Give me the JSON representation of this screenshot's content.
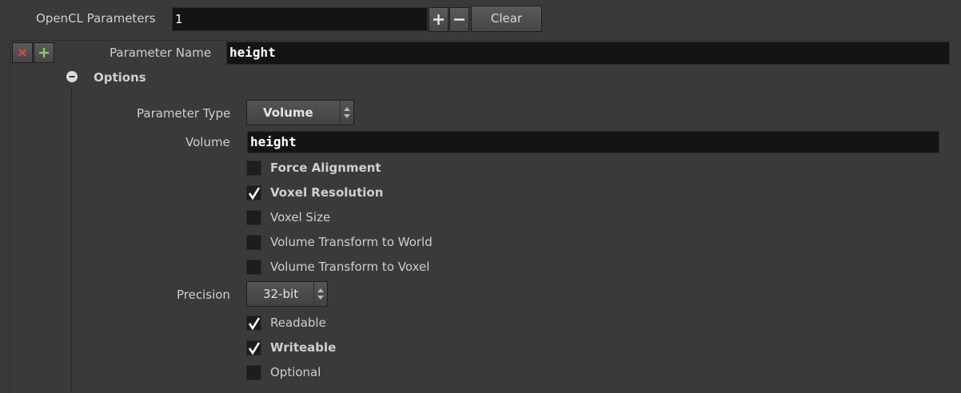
{
  "opencl": {
    "label": "OpenCL Parameters",
    "count": "1",
    "clear_label": "Clear"
  },
  "param": {
    "name_label": "Parameter Name",
    "name_value": "height"
  },
  "options": {
    "title": "Options",
    "type_label": "Parameter Type",
    "type_value": "Volume",
    "volume_label": "Volume",
    "volume_value": "height",
    "checkboxes": [
      {
        "label": "Force Alignment",
        "checked": false
      },
      {
        "label": "Voxel Resolution",
        "checked": true
      },
      {
        "label": "Voxel Size",
        "checked": false
      },
      {
        "label": "Volume Transform to World",
        "checked": false
      },
      {
        "label": "Volume Transform to Voxel",
        "checked": false
      }
    ],
    "precision_label": "Precision",
    "precision_value": "32-bit",
    "checkboxes2": [
      {
        "label": "Readable",
        "checked": true
      },
      {
        "label": "Writeable",
        "checked": true
      },
      {
        "label": "Optional",
        "checked": false
      }
    ]
  },
  "colors": {
    "bg": "#3a3a3a",
    "field_bg": "#141414",
    "delete_red": "#e04040",
    "add_green": "#8ccf6a"
  }
}
